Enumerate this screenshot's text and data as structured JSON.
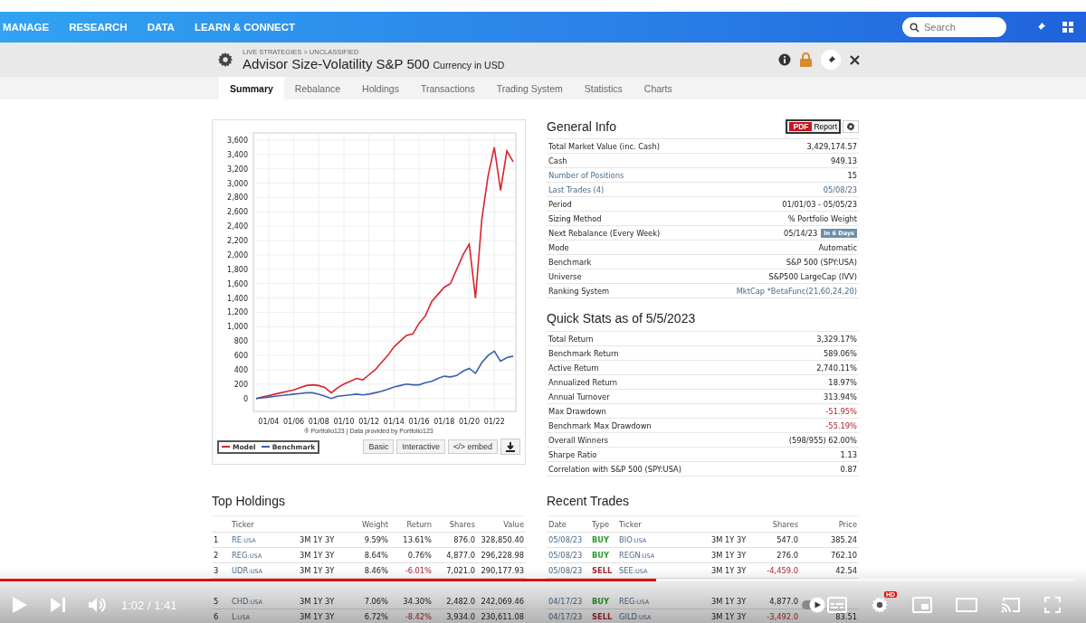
{
  "nav": {
    "items": [
      "MANAGE",
      "RESEARCH",
      "DATA",
      "LEARN & CONNECT"
    ],
    "search": {
      "placeholder": "Search"
    }
  },
  "header": {
    "breadcrumb": "LIVE STRATEGIES > UNCLASSIFIED",
    "title": "Advisor Size-Volatility S&P 500",
    "currency": "Currency in USD"
  },
  "tabs": [
    {
      "label": "Summary",
      "selected": true
    },
    {
      "label": "Rebalance",
      "selected": false
    },
    {
      "label": "Holdings",
      "selected": false
    },
    {
      "label": "Transactions",
      "selected": false
    },
    {
      "label": "Trading System",
      "selected": false
    },
    {
      "label": "Statistics",
      "selected": false
    },
    {
      "label": "Charts",
      "selected": false
    }
  ],
  "chart": {
    "chart_data": {
      "type": "line",
      "categories": [
        null,
        null,
        "01/04",
        null,
        null,
        null,
        "01/06",
        null,
        null,
        null,
        "01/08",
        null,
        null,
        null,
        "01/10",
        null,
        null,
        null,
        "01/12",
        null,
        null,
        null,
        "01/14",
        null,
        null,
        null,
        "01/16",
        null,
        null,
        null,
        "01/18",
        null,
        null,
        null,
        "01/20",
        null,
        null,
        null,
        "01/22",
        null,
        null,
        null
      ],
      "series": [
        {
          "name": "Model",
          "color": "#d9232e",
          "values": [
            0,
            20,
            40,
            60,
            80,
            100,
            120,
            150,
            180,
            190,
            180,
            150,
            80,
            150,
            200,
            240,
            280,
            260,
            330,
            400,
            500,
            600,
            720,
            800,
            880,
            900,
            1050,
            1150,
            1350,
            1450,
            1550,
            1600,
            1800,
            2000,
            2150,
            1400,
            2500,
            3100,
            3500,
            2900,
            3450,
            3300
          ]
        },
        {
          "name": "Benchmark",
          "color": "#3a5fb0",
          "values": [
            0,
            10,
            20,
            30,
            40,
            50,
            60,
            70,
            80,
            80,
            60,
            30,
            0,
            30,
            40,
            50,
            60,
            50,
            60,
            80,
            100,
            130,
            160,
            180,
            200,
            190,
            190,
            220,
            240,
            280,
            310,
            300,
            320,
            380,
            420,
            350,
            500,
            600,
            660,
            520,
            570,
            590
          ]
        }
      ],
      "ylim": [
        -180,
        3700
      ],
      "grid": true,
      "yticks": [
        {
          "value": 0,
          "label": "0"
        },
        {
          "value": 200,
          "label": "200"
        },
        {
          "value": 400,
          "label": "400"
        },
        {
          "value": 600,
          "label": "600"
        },
        {
          "value": 800,
          "label": "800"
        },
        {
          "value": 1000,
          "label": "1,000"
        },
        {
          "value": 1200,
          "label": "1,200"
        },
        {
          "value": 1400,
          "label": "1,400"
        },
        {
          "value": 1600,
          "label": "1,600"
        },
        {
          "value": 1800,
          "label": "1,800"
        },
        {
          "value": 2000,
          "label": "2,000"
        },
        {
          "value": 2200,
          "label": "2,200"
        },
        {
          "value": 2400,
          "label": "2,400"
        },
        {
          "value": 2600,
          "label": "2,600"
        },
        {
          "value": 2800,
          "label": "2,800"
        },
        {
          "value": 3000,
          "label": "3,000"
        },
        {
          "value": 3200,
          "label": "3,200"
        },
        {
          "value": 3400,
          "label": "3,400"
        },
        {
          "value": 3600,
          "label": "3,600"
        }
      ]
    },
    "credit": "® Portfolio123 | Data provided by Portfolio123",
    "buttons": [
      "Basic",
      "Interactive",
      "</> embed"
    ]
  },
  "general_info": {
    "title": "General Info",
    "pdf": "PDF",
    "report": "Report",
    "rows": [
      {
        "label": "Total Market Value (inc. Cash)",
        "value": "3,429,174.57",
        "link": false,
        "value_link": false
      },
      {
        "label": "Cash",
        "value": "949.13",
        "link": false,
        "value_link": false
      },
      {
        "label": "Number of Positions",
        "value": "15",
        "link": true,
        "value_link": false
      },
      {
        "label": "Last Trades (4)",
        "value": "05/08/23",
        "link": true,
        "value_link": true
      },
      {
        "label": "Period",
        "value": "01/01/03 - 05/05/23",
        "link": false,
        "value_link": false
      },
      {
        "label": "Sizing Method",
        "value": "% Portfolio Weight",
        "link": false,
        "value_link": false
      },
      {
        "label": "Next Rebalance (Every Week)",
        "value": "05/14/23",
        "badge": "In 6 Days",
        "link": false,
        "value_link": false
      },
      {
        "label": "Mode",
        "value": "Automatic",
        "link": false,
        "value_link": false
      },
      {
        "label": "Benchmark",
        "value": "S&P 500 (SPY:USA)",
        "link": false,
        "value_link": false
      },
      {
        "label": "Universe",
        "value": "S&P500 LargeCap (IVV)",
        "link": false,
        "value_link": false
      },
      {
        "label": "Ranking System",
        "value": "MktCap *BetaFunc(21,60,24,20)",
        "link": false,
        "value_link": true
      }
    ]
  },
  "quick_stats": {
    "title": "Quick Stats as of 5/5/2023",
    "rows": [
      {
        "label": "Total Return",
        "value": "3,329.17%",
        "negative": false
      },
      {
        "label": "Benchmark Return",
        "value": "589.06%",
        "negative": false
      },
      {
        "label": "Active Return",
        "value": "2,740.11%",
        "negative": false
      },
      {
        "label": "Annualized Return",
        "value": "18.97%",
        "negative": false
      },
      {
        "label": "Annual Turnover",
        "value": "313.94%",
        "negative": false
      },
      {
        "label": "Max Drawdown",
        "value": "-51.95%",
        "negative": true
      },
      {
        "label": "Benchmark Max Drawdown",
        "value": "-55.19%",
        "negative": true
      },
      {
        "label": "Overall Winners",
        "value": "(598/955) 62.00%",
        "negative": false
      },
      {
        "label": "Sharpe Ratio",
        "value": "1.13",
        "negative": false
      },
      {
        "label": "Correlation with S&P 500 (SPY:USA)",
        "value": "0.87",
        "negative": false
      }
    ]
  },
  "holdings": {
    "title": "Top Holdings",
    "columns": [
      "Ticker",
      "Weight",
      "Return",
      "Shares",
      "Value"
    ],
    "rows": [
      {
        "rank": "1",
        "ticker": "RE",
        "suffix": ":USA",
        "periods": "3M 1Y 3Y",
        "weight": "9.59%",
        "return": "13.61%",
        "negative": false,
        "shares": "876.0",
        "value": "328,850.40"
      },
      {
        "rank": "2",
        "ticker": "REG",
        "suffix": ":USA",
        "periods": "3M 1Y 3Y",
        "weight": "8.64%",
        "return": "0.76%",
        "negative": false,
        "shares": "4,877.0",
        "value": "296,228.98"
      },
      {
        "rank": "3",
        "ticker": "UDR",
        "suffix": ":USA",
        "periods": "3M 1Y 3Y",
        "weight": "8.46%",
        "return": "-6.01%",
        "negative": true,
        "shares": "7,021.0",
        "value": "290,177.93"
      },
      {
        "rank": "5",
        "ticker": "CHD",
        "suffix": ":USA",
        "periods": "3M 1Y 3Y",
        "weight": "7.06%",
        "return": "34.30%",
        "negative": false,
        "shares": "2,482.0",
        "value": "242,069.46"
      },
      {
        "rank": "6",
        "ticker": "L",
        "suffix": ":USA",
        "periods": "3M 1Y 3Y",
        "weight": "6.72%",
        "return": "-8.42%",
        "negative": true,
        "shares": "3,934.0",
        "value": "230,611.08"
      }
    ]
  },
  "trades": {
    "title": "Recent Trades",
    "columns": [
      "Date",
      "Type",
      "Ticker",
      "Shares",
      "Price"
    ],
    "rows": [
      {
        "date": "05/08/23",
        "type": "BUY",
        "kind": "buy",
        "ticker": "BIO",
        "suffix": ":USA",
        "periods": "3M 1Y 3Y",
        "shares": "547.0",
        "negative": false,
        "price": "385.24"
      },
      {
        "date": "05/08/23",
        "type": "BUY",
        "kind": "buy",
        "ticker": "REGN",
        "suffix": ":USA",
        "periods": "3M 1Y 3Y",
        "shares": "276.0",
        "negative": false,
        "price": "762.10"
      },
      {
        "date": "05/08/23",
        "type": "SELL",
        "kind": "sell",
        "ticker": "SEE",
        "suffix": ":USA",
        "periods": "3M 1Y 3Y",
        "shares": "-4,459.0",
        "negative": true,
        "price": "42.54"
      },
      {
        "date": "04/17/23",
        "type": "BUY",
        "kind": "buy",
        "ticker": "REG",
        "suffix": ":USA",
        "periods": "3M 1Y 3Y",
        "shares": "4,877.0",
        "negative": false
      },
      {
        "date": "04/17/23",
        "type": "SELL",
        "kind": "sell",
        "ticker": "GILD",
        "suffix": ":USA",
        "periods": "3M 1Y 3Y",
        "shares": "-3,492.0",
        "negative": true,
        "price": "83.51"
      }
    ]
  },
  "player": {
    "time": "1:02 / 1:41",
    "level": 0.61,
    "hd": "HD"
  }
}
